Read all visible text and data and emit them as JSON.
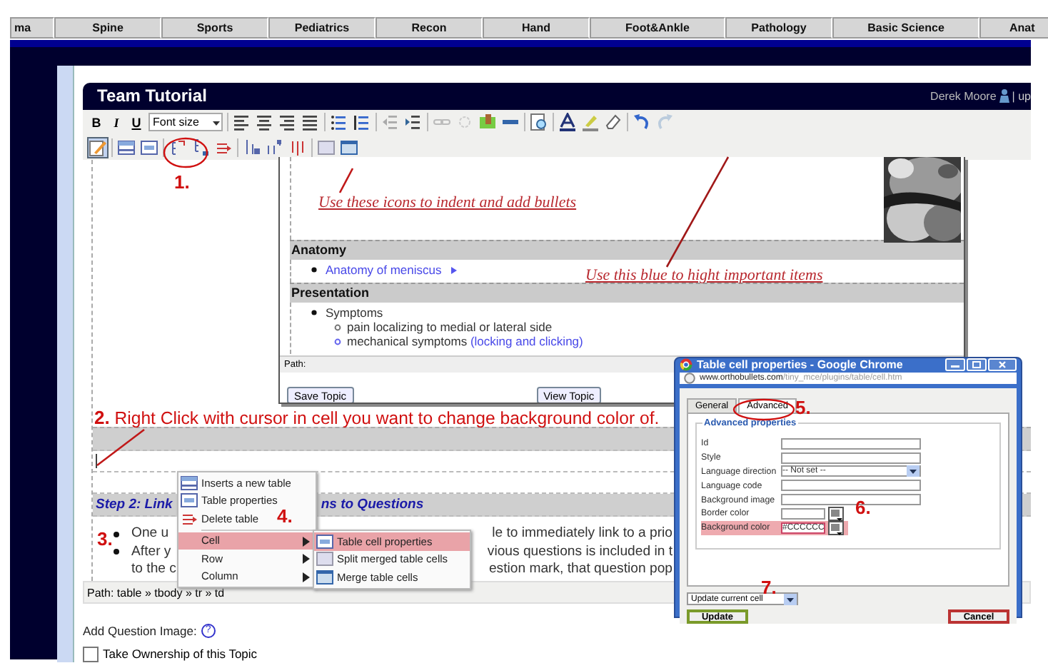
{
  "nav_tabs": [
    "ma",
    "Spine",
    "Sports",
    "Pediatrics",
    "Recon",
    "Hand",
    "Foot&Ankle",
    "Pathology",
    "Basic Science",
    "Anat"
  ],
  "editor": {
    "title": "Team Tutorial",
    "user": "Derek Moore",
    "user_link": "| up",
    "toolbar": {
      "format_buttons": [
        "B",
        "I",
        "U"
      ],
      "font_size": "Font size",
      "row_2_buttons": [
        {
          "selected": true
        },
        {
          "selected": false
        },
        {
          "selected": false
        },
        {
          "selected": false
        },
        {
          "selected": false
        },
        {
          "selected": false
        },
        {
          "selected": false
        },
        {
          "selected": false
        },
        {
          "selected": false
        },
        {
          "selected": false
        },
        {
          "selected": false
        }
      ]
    },
    "rows": [
      {
        "kind": "blank"
      },
      {
        "kind": "shaded"
      },
      {
        "kind": "cursor"
      },
      {
        "kind": "blank_small"
      },
      {
        "kind": "heading",
        "left": "Step 2: Link",
        "right": "ns to Questions"
      },
      {
        "kind": "bullets",
        "lines": [
          {
            "bullet": true,
            "left": "One u",
            "right": "le to immediately link to a prio"
          },
          {
            "bullet": true,
            "left": "After y",
            "right": "vious questions is included in t"
          },
          {
            "bullet": false,
            "left": "to the c",
            "right": "estion mark, that question pop"
          }
        ]
      }
    ],
    "path": "Path: table » tbody » tr » td"
  },
  "add_question_image": "Add Question Image:",
  "help": "?",
  "ownership": {
    "label": "Take Ownership of this Topic",
    "checked": false
  },
  "preview": {
    "note_indent": "Use these icons to indent and add bullets",
    "note_blue": "Use this blue to hight important items",
    "sections": [
      {
        "heading": "Anatomy",
        "items": [
          {
            "link": "Anatomy of meniscus",
            "arrow": true
          }
        ]
      },
      {
        "heading": "Presentation",
        "items": [
          {
            "text": "Symptoms",
            "children": [
              {
                "text": "pain localizing to medial or lateral side"
              },
              {
                "text": "mechanical symptoms ",
                "link": "(locking and clicking)"
              }
            ]
          }
        ]
      }
    ],
    "path": "Path:",
    "buttons": [
      "Save Topic",
      "View Topic"
    ]
  },
  "context_menu": {
    "items": [
      {
        "label": "Inserts a new table",
        "kind": "action",
        "selected": false
      },
      {
        "label": "Table properties",
        "kind": "action",
        "selected": false
      },
      {
        "label": "Delete table",
        "kind": "action",
        "selected": false
      },
      {
        "label": "Cell",
        "kind": "submenu",
        "selected": true
      },
      {
        "label": "Row",
        "kind": "submenu",
        "selected": false
      },
      {
        "label": "Column",
        "kind": "submenu",
        "selected": false
      }
    ]
  },
  "submenu": {
    "items": [
      {
        "label": "Table cell properties",
        "selected": true
      },
      {
        "label": "Split merged table cells",
        "selected": false
      },
      {
        "label": "Merge table cells",
        "selected": false
      }
    ]
  },
  "dialog": {
    "title": "Table cell properties - Google Chrome",
    "url_host": "www.orthobullets.com",
    "url_path": "/tiny_mce/plugins/table/cell.htm",
    "tabs": [
      {
        "label": "General",
        "selected": false
      },
      {
        "label": "Advanced",
        "selected": true
      }
    ],
    "legend": "Advanced properties",
    "fields": [
      {
        "label": "Id",
        "kind": "text",
        "highlighted": false
      },
      {
        "label": "Style",
        "kind": "text",
        "highlighted": false
      },
      {
        "label": "Language direction",
        "kind": "select",
        "value": "-- Not set --",
        "highlighted": false
      },
      {
        "label": "Language code",
        "kind": "text",
        "highlighted": false
      },
      {
        "label": "Background image",
        "kind": "text",
        "highlighted": false
      },
      {
        "label": "Border color",
        "kind": "color",
        "highlighted": false
      },
      {
        "label": "Background color",
        "kind": "color",
        "value": "#CCCCCC",
        "highlighted": true
      }
    ],
    "action": "Update current cell",
    "update": "Update",
    "cancel": "Cancel"
  },
  "annotations": {
    "step_1": "1.",
    "instruction_2": "**2.** Right Click with cursor in cell you want to change background color of.",
    "step_3": "3.",
    "step_4": "4.",
    "step_5": "5.",
    "step_6": "6.",
    "step_7": "7."
  }
}
